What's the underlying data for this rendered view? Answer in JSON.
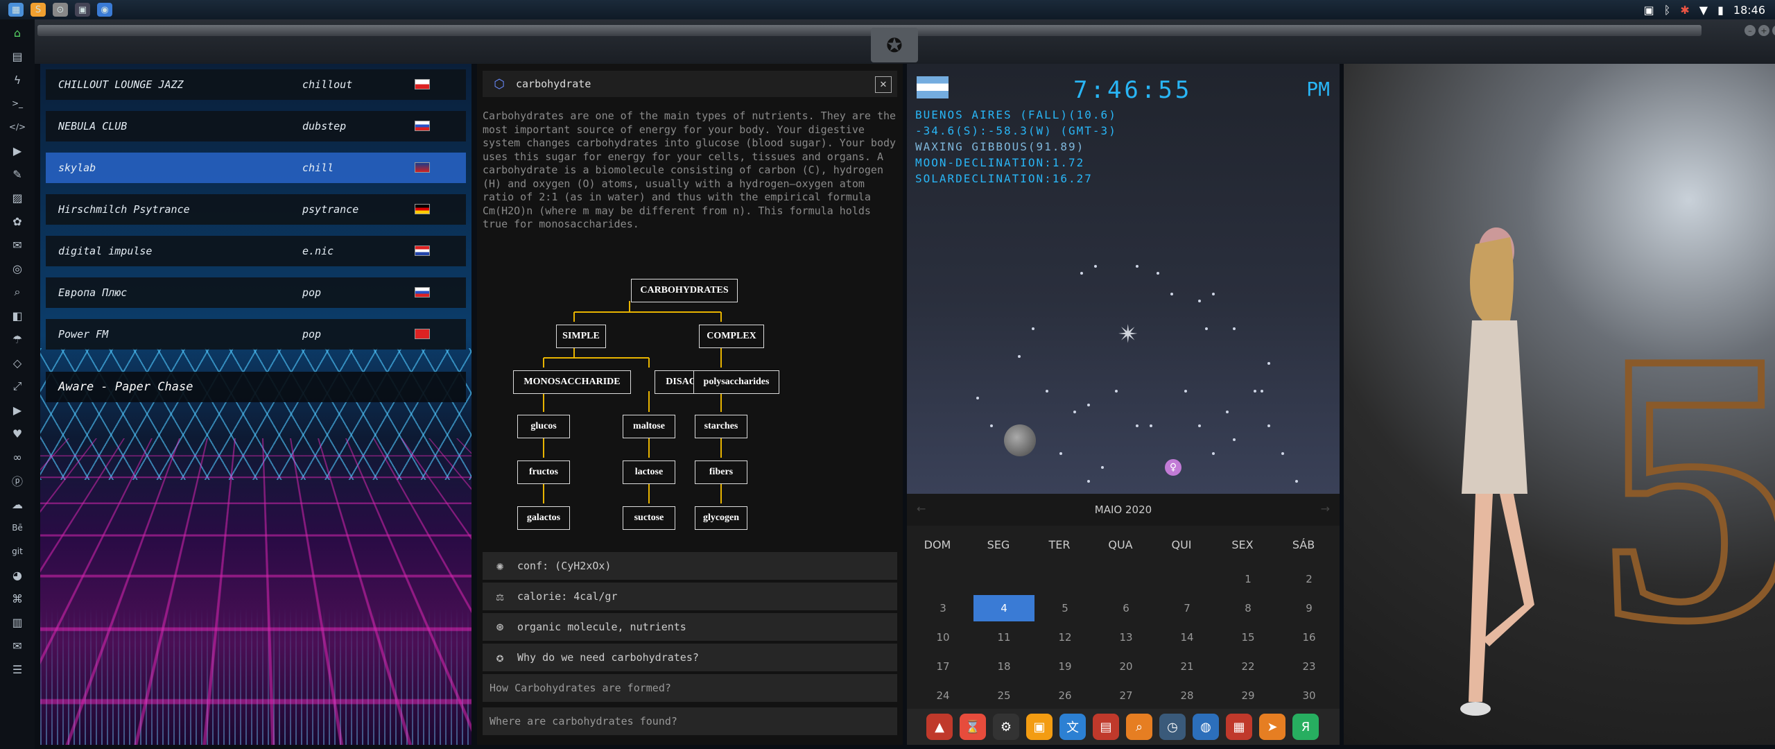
{
  "topbar": {
    "clock": "18:46",
    "apps": [
      {
        "icon": "files-icon",
        "color": "#4a90d9"
      },
      {
        "icon": "sublime-icon",
        "color": "#f0a030"
      },
      {
        "icon": "sl-icon",
        "color": "#888"
      },
      {
        "icon": "terminal-icon",
        "color": "#445"
      },
      {
        "icon": "browser-icon",
        "color": "#3a7bd5"
      }
    ]
  },
  "sidebar": {
    "items": [
      "home",
      "doc",
      "power",
      "terminal",
      "code",
      "play",
      "note",
      "image",
      "gear",
      "mail",
      "globe",
      "search",
      "user",
      "umbrella",
      "tag",
      "expand",
      "youtube",
      "heart",
      "link",
      "pinterest",
      "cloud",
      "behance",
      "git",
      "github",
      "network",
      "map",
      "mail2",
      "server"
    ]
  },
  "radio": {
    "stations": [
      {
        "name": "CHILLOUT LOUNGE JAZZ",
        "genre": "chillout",
        "flag": "pl"
      },
      {
        "name": "NEBULA CLUB",
        "genre": "dubstep",
        "flag": "ru"
      },
      {
        "name": "skylab",
        "genre": "chill",
        "flag": "uk",
        "selected": true
      },
      {
        "name": "Hirschmilch Psytrance",
        "genre": "psytrance",
        "flag": "de"
      },
      {
        "name": "digital impulse",
        "genre": "e.nic",
        "flag": "hr"
      },
      {
        "name": "Европа Плюс",
        "genre": "pop",
        "flag": "ru"
      },
      {
        "name": "Power FM",
        "genre": "pop",
        "flag": "tr"
      }
    ],
    "now_playing": "Aware - Paper Chase"
  },
  "carb": {
    "title": "carbohydrate",
    "description": "Carbohydrates are one of the main types of nutrients. They are the most important source of energy for your body. Your digestive system changes carbohydrates into glucose (blood sugar). Your body uses this sugar for energy for your cells, tissues and organs. A carbohydrate is a biomolecule consisting of carbon (C), hydrogen (H) and oxygen (O) atoms, usually with a hydrogen–oxygen atom ratio of 2:1 (as in water) and thus with the empirical formula Cm(H2O)n (where m may be different from n). This formula holds true for monosaccharides.",
    "tree": {
      "root": "CARBOHYDRATES",
      "simple": "SIMPLE",
      "complex": "COMPLEX",
      "mono": "MONOSACCHARIDE",
      "di": "DISACCHARIDES",
      "poly": "polysaccharides",
      "mono_items": [
        "glucos",
        "fructos",
        "galactos"
      ],
      "di_items": [
        "maltose",
        "lactose",
        "suctose"
      ],
      "poly_items": [
        "starches",
        "fibers",
        "glycogen"
      ]
    },
    "rows": [
      {
        "icon": "atom-icon",
        "text": "conf: (CyH2xOx)"
      },
      {
        "icon": "scale-icon",
        "text": "calorie: 4cal/gr"
      },
      {
        "icon": "molecule-icon",
        "text": "organic molecule, nutrients"
      },
      {
        "icon": "question-icon",
        "text": "Why do we need carbohydrates?"
      }
    ],
    "questions": [
      "How Carbohydrates are formed?",
      "Where are carbohydrates found?"
    ]
  },
  "clock": {
    "time": "7:46:55",
    "ampm": "PM",
    "info": [
      "BUENOS AIRES (FALL)(10.6)",
      "-34.6(S):-58.3(W) (GMT-3)",
      "WAXING GIBBOUS(91.89)",
      "MOON-DECLINATION:1.72",
      "SOLARDECLINATION:16.27"
    ]
  },
  "calendar": {
    "month": "MAIO 2020",
    "days": [
      "DOM",
      "SEG",
      "TER",
      "QUA",
      "QUI",
      "SEX",
      "SÁB"
    ],
    "weeks": [
      [
        "",
        "",
        "",
        "",
        "",
        "1",
        "2"
      ],
      [
        "3",
        "4",
        "5",
        "6",
        "7",
        "8",
        "9"
      ],
      [
        "10",
        "11",
        "12",
        "13",
        "14",
        "15",
        "16"
      ],
      [
        "17",
        "18",
        "19",
        "20",
        "21",
        "22",
        "23"
      ],
      [
        "24",
        "25",
        "26",
        "27",
        "28",
        "29",
        "30"
      ]
    ],
    "today": "4"
  },
  "dock": [
    {
      "icon": "app-red-icon",
      "color": "#c0392b"
    },
    {
      "icon": "hourglass-icon",
      "color": "#e74c3c"
    },
    {
      "icon": "steam-icon",
      "color": "#333"
    },
    {
      "icon": "photos-icon",
      "color": "#f39c12"
    },
    {
      "icon": "translate-icon",
      "color": "#2c80d3"
    },
    {
      "icon": "reader-icon",
      "color": "#c0392b"
    },
    {
      "icon": "search-icon",
      "color": "#e67e22"
    },
    {
      "icon": "clock-icon",
      "color": "#3a5a7a"
    },
    {
      "icon": "globe-icon",
      "color": "#2c6fbb"
    },
    {
      "icon": "calendar-icon",
      "color": "#c0392b"
    },
    {
      "icon": "arrow-icon",
      "color": "#e67e22"
    },
    {
      "icon": "yandex-icon",
      "color": "#27ae60"
    }
  ]
}
